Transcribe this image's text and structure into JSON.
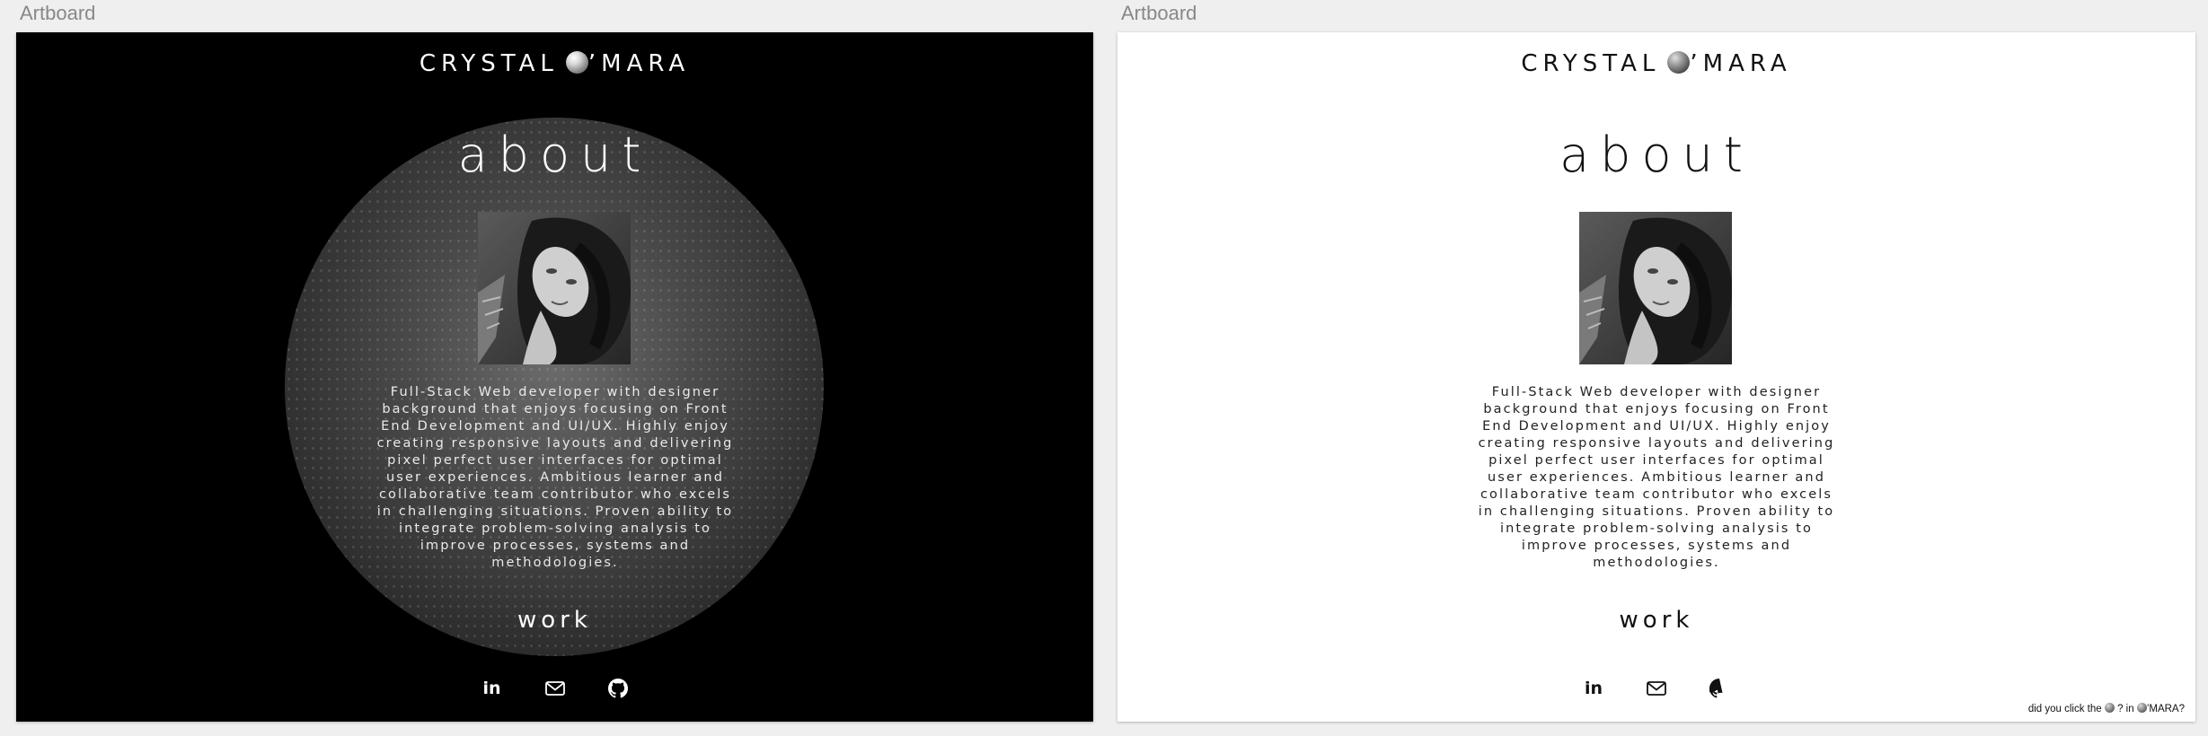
{
  "artboards": {
    "left_label": "Artboard",
    "right_label": "Artboard"
  },
  "brand": {
    "before": "CRYSTAL",
    "after": "’MARA"
  },
  "page": {
    "heading": "about",
    "bio": "Full-Stack Web developer with designer background that enjoys focusing on Front End Development and UI/UX. Highly enjoy creating responsive layouts and delivering pixel perfect user interfaces for optimal user experiences. Ambitious learner and collaborative team contributor who excels in challenging situations. Proven ability to integrate problem-solving analysis to improve processes, systems and methodologies.",
    "work_link": "work"
  },
  "socials": {
    "icons": [
      "linkedin-icon",
      "mail-icon",
      "github-icon"
    ],
    "linkedin_glyph": "in"
  },
  "easter_egg": {
    "part1": "did you click the",
    "part2": "? in",
    "part3": "’MARA?"
  },
  "colors": {
    "dark_bg": "#000000",
    "light_bg": "#ffffff",
    "canvas_bg": "#efefef"
  }
}
